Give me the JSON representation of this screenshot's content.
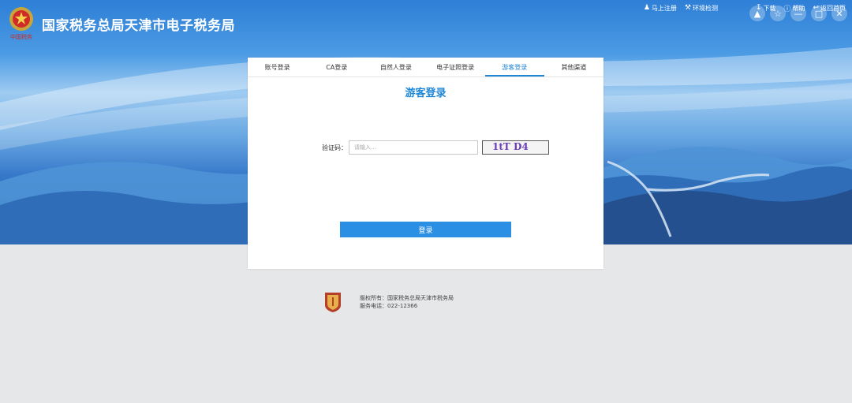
{
  "header": {
    "title": "国家税务总局天津市电子税务局",
    "logo_text": "中国税务"
  },
  "toplinks": [
    {
      "label": "马上注册",
      "icon": "user-icon"
    },
    {
      "label": "环境检测",
      "icon": "wrench-icon"
    },
    {
      "label": "下载",
      "icon": "download-icon"
    },
    {
      "label": "帮助",
      "icon": "help-icon"
    },
    {
      "label": "返回首页",
      "icon": "back-icon"
    }
  ],
  "window_controls": [
    {
      "icon": "shirt-icon"
    },
    {
      "icon": "star-icon"
    },
    {
      "icon": "minimize-icon"
    },
    {
      "icon": "maximize-icon"
    },
    {
      "icon": "close-icon"
    }
  ],
  "tabs": [
    {
      "label": "账号登录",
      "active": false
    },
    {
      "label": "CA登录",
      "active": false
    },
    {
      "label": "自然人登录",
      "active": false
    },
    {
      "label": "电子证照登录",
      "active": false
    },
    {
      "label": "游客登录",
      "active": true
    },
    {
      "label": "其他渠道",
      "active": false
    }
  ],
  "form": {
    "title": "游客登录",
    "captcha_label": "验证码：",
    "captcha_placeholder": "请输入...",
    "captcha_value": "",
    "captcha_text": "1tT D4",
    "login_button": "登录"
  },
  "footer": {
    "copyright": "版权所有：国家税务总局天津市税务局",
    "phone": "服务电话：022-12366"
  },
  "colors": {
    "accent": "#1f86d6",
    "button": "#2b8fe4"
  }
}
